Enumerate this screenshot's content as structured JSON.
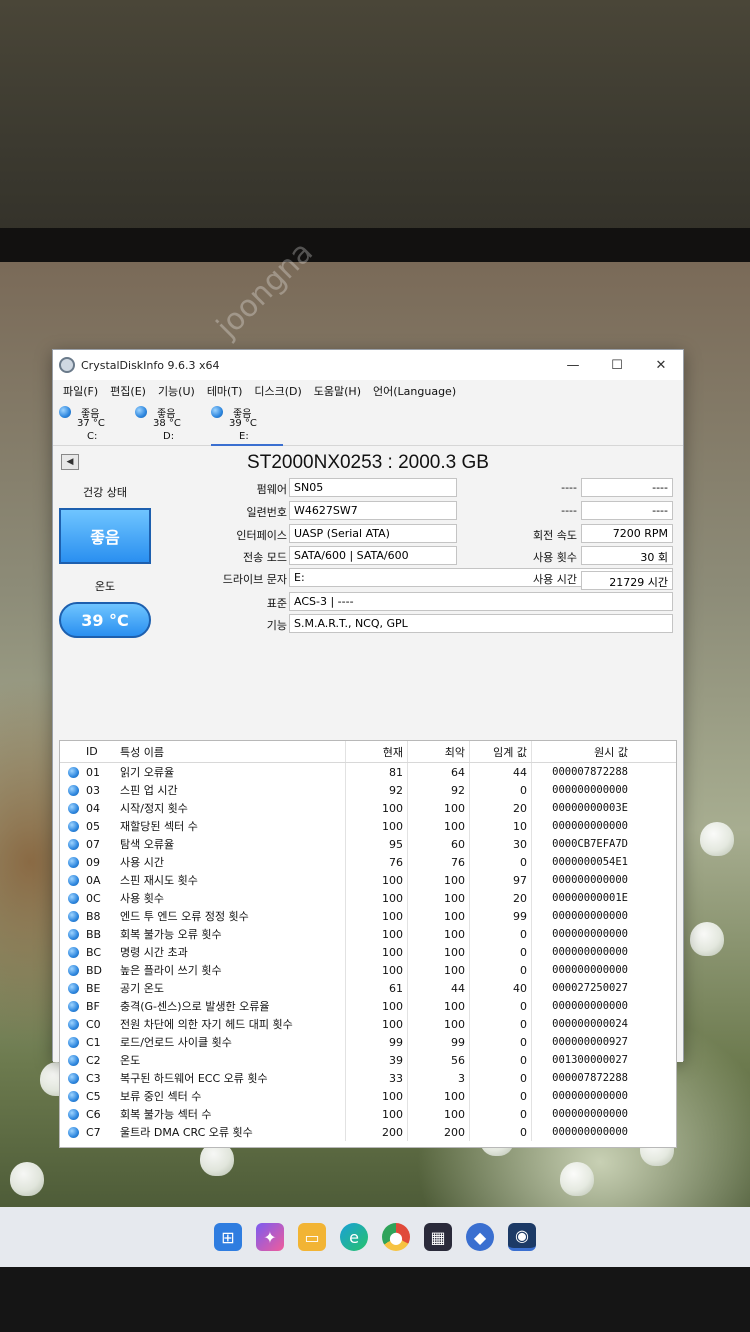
{
  "window": {
    "title": "CrystalDiskInfo 9.6.3 x64",
    "minimize": "—",
    "maximize": "☐",
    "close": "✕"
  },
  "menu": [
    "파일(F)",
    "편집(E)",
    "기능(U)",
    "테마(T)",
    "디스크(D)",
    "도움말(H)",
    "언어(Language)"
  ],
  "drives": [
    {
      "status": "좋음",
      "temp": "37 °C",
      "letter": "C:"
    },
    {
      "status": "좋음",
      "temp": "38 °C",
      "letter": "D:"
    },
    {
      "status": "좋음",
      "temp": "39 °C",
      "letter": "E:"
    }
  ],
  "disk": {
    "model": "ST2000NX0253 : 2000.3 GB",
    "health_label": "건강 상태",
    "health_value": "좋음",
    "temp_label": "온도",
    "temp_value": "39 °C",
    "firmware_label": "펌웨어",
    "firmware": "SN05",
    "serial_label": "일련번호",
    "serial": "W4627SW7",
    "interface_label": "인터페이스",
    "interface": "UASP (Serial ATA)",
    "transfer_label": "전송 모드",
    "transfer": "SATA/600 | SATA/600",
    "drive_letter_label": "드라이브 문자",
    "drive_letter": "E:",
    "standard_label": "표준",
    "standard": "ACS-3 | ----",
    "features_label": "기능",
    "features": "S.M.A.R.T., NCQ, GPL",
    "r1_label": "----",
    "r1_value": "----",
    "r2_label": "----",
    "r2_value": "----",
    "rotation_label": "회전 속도",
    "rotation": "7200 RPM",
    "power_count_label": "사용 횟수",
    "power_count": "30 회",
    "power_hours_label": "사용 시간",
    "power_hours": "21729 시간"
  },
  "smart": {
    "headers": {
      "id": "ID",
      "name": "특성 이름",
      "current": "현재",
      "worst": "최악",
      "threshold": "임계 값",
      "raw": "원시 값"
    },
    "rows": [
      {
        "id": "01",
        "name": "읽기 오류율",
        "current": "81",
        "worst": "64",
        "threshold": "44",
        "raw": "000007872288"
      },
      {
        "id": "03",
        "name": "스핀 업 시간",
        "current": "92",
        "worst": "92",
        "threshold": "0",
        "raw": "000000000000"
      },
      {
        "id": "04",
        "name": "시작/정지 횟수",
        "current": "100",
        "worst": "100",
        "threshold": "20",
        "raw": "00000000003E"
      },
      {
        "id": "05",
        "name": "재할당된 섹터 수",
        "current": "100",
        "worst": "100",
        "threshold": "10",
        "raw": "000000000000"
      },
      {
        "id": "07",
        "name": "탐색 오류율",
        "current": "95",
        "worst": "60",
        "threshold": "30",
        "raw": "0000CB7EFA7D"
      },
      {
        "id": "09",
        "name": "사용 시간",
        "current": "76",
        "worst": "76",
        "threshold": "0",
        "raw": "0000000054E1"
      },
      {
        "id": "0A",
        "name": "스핀 재시도 횟수",
        "current": "100",
        "worst": "100",
        "threshold": "97",
        "raw": "000000000000"
      },
      {
        "id": "0C",
        "name": "사용 횟수",
        "current": "100",
        "worst": "100",
        "threshold": "20",
        "raw": "00000000001E"
      },
      {
        "id": "B8",
        "name": "엔드 투 엔드 오류 정정 횟수",
        "current": "100",
        "worst": "100",
        "threshold": "99",
        "raw": "000000000000"
      },
      {
        "id": "BB",
        "name": "회복 불가능 오류 횟수",
        "current": "100",
        "worst": "100",
        "threshold": "0",
        "raw": "000000000000"
      },
      {
        "id": "BC",
        "name": "명령 시간 초과",
        "current": "100",
        "worst": "100",
        "threshold": "0",
        "raw": "000000000000"
      },
      {
        "id": "BD",
        "name": "높은 플라이 쓰기 횟수",
        "current": "100",
        "worst": "100",
        "threshold": "0",
        "raw": "000000000000"
      },
      {
        "id": "BE",
        "name": "공기 온도",
        "current": "61",
        "worst": "44",
        "threshold": "40",
        "raw": "000027250027"
      },
      {
        "id": "BF",
        "name": "충격(G-센스)으로 발생한 오류율",
        "current": "100",
        "worst": "100",
        "threshold": "0",
        "raw": "000000000000"
      },
      {
        "id": "C0",
        "name": "전원 차단에 의한 자기 헤드 대피 횟수",
        "current": "100",
        "worst": "100",
        "threshold": "0",
        "raw": "000000000024"
      },
      {
        "id": "C1",
        "name": "로드/언로드 사이클 횟수",
        "current": "99",
        "worst": "99",
        "threshold": "0",
        "raw": "000000000927"
      },
      {
        "id": "C2",
        "name": "온도",
        "current": "39",
        "worst": "56",
        "threshold": "0",
        "raw": "001300000027"
      },
      {
        "id": "C3",
        "name": "복구된 하드웨어 ECC 오류 횟수",
        "current": "33",
        "worst": "3",
        "threshold": "0",
        "raw": "000007872288"
      },
      {
        "id": "C5",
        "name": "보류 중인 섹터 수",
        "current": "100",
        "worst": "100",
        "threshold": "0",
        "raw": "000000000000"
      },
      {
        "id": "C6",
        "name": "회복 불가능 섹터 수",
        "current": "100",
        "worst": "100",
        "threshold": "0",
        "raw": "000000000000"
      },
      {
        "id": "C7",
        "name": "울트라 DMA CRC 오류 횟수",
        "current": "200",
        "worst": "200",
        "threshold": "0",
        "raw": "000000000000"
      }
    ]
  },
  "colors": {
    "status_good": "#2a8ff0",
    "accent": "#3a6fd0"
  },
  "taskbar_icons": [
    "windows-start-icon",
    "copilot-icon",
    "file-explorer-icon",
    "edge-icon",
    "chrome-icon",
    "store-icon",
    "app-icon",
    "crystaldiskinfo-icon"
  ]
}
